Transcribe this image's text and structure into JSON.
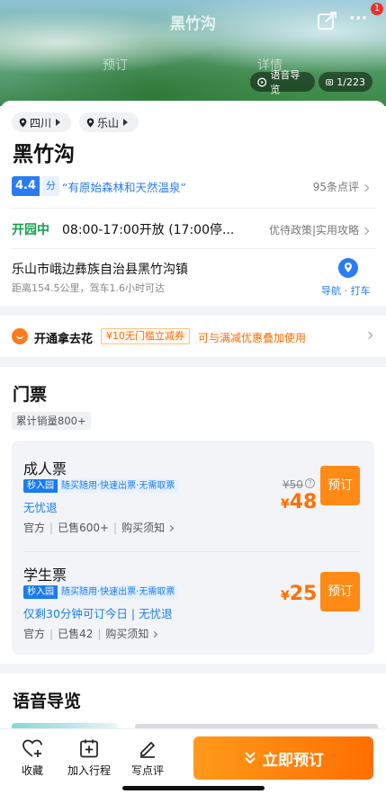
{
  "hero": {
    "title": "黑竹沟",
    "ghost_1": "预订",
    "ghost_2": "详情",
    "notification_count": "1",
    "audio_guide": "语音导览",
    "photo_count": "1/223"
  },
  "location": {
    "province": "四川",
    "city": "乐山"
  },
  "attraction": {
    "name": "黑竹沟",
    "score": "4.4",
    "score_unit": "分",
    "quote": "“有原始森林和天然温泉”",
    "reviews": "95条点评"
  },
  "hours": {
    "status": "开园中",
    "text": "08:00-17:00开放 (17:00停...",
    "links": "优待政策|实用攻略"
  },
  "address": {
    "text": "乐山市峨边彝族自治县黑竹沟镇",
    "distance": "距离154.5公里，驾车1.6小时可达",
    "nav_label": "导航 · 打车"
  },
  "promo": {
    "text": "开通拿去花",
    "coupon": "¥10无门槛立减券",
    "note": "可与满减优惠叠加使用"
  },
  "tickets": {
    "section_title": "门票",
    "sales": "累计销量800+",
    "items": [
      {
        "name": "成人票",
        "badge_dark": "秒入园",
        "badge_light": "随买随用·快速出票·无需取票",
        "note": "无忧退",
        "meta_1": "官方",
        "meta_2": "已售600+",
        "meta_3": "购买须知",
        "original_price": "¥50",
        "price_symbol": "¥",
        "price": "48",
        "book": "预订"
      },
      {
        "name": "学生票",
        "badge_dark": "秒入园",
        "badge_light": "随买随用·快速出票·无需取票",
        "note": "仅剩30分钟可订今日 | 无忧退",
        "meta_1": "官方",
        "meta_2": "已售42",
        "meta_3": "购买须知",
        "price_symbol": "¥",
        "price": "25",
        "book": "预订"
      }
    ]
  },
  "audio": {
    "section_title": "语音导览"
  },
  "bottom_bar": {
    "favorite": "收藏",
    "add_trip": "加入行程",
    "review": "写点评",
    "cta": "立即预订"
  },
  "colors": {
    "accent_blue": "#2a7cf4",
    "open_green": "#11a14a",
    "price_orange": "#ff7000",
    "cta_orange": "#ff7a0a"
  }
}
